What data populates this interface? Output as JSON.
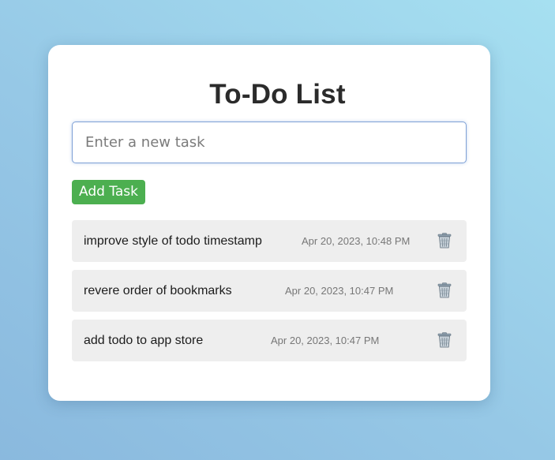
{
  "app": {
    "title": "To-Do List"
  },
  "input": {
    "placeholder": "Enter a new task",
    "value": ""
  },
  "add_button": {
    "label": "Add Task"
  },
  "tasks": [
    {
      "text": "improve style of todo timestamp",
      "timestamp": "Apr 20, 2023, 10:48 PM",
      "icon": "trash-icon"
    },
    {
      "text": "revere order of bookmarks",
      "timestamp": "Apr 20, 2023, 10:47 PM",
      "icon": "trash-icon"
    },
    {
      "text": "add todo to app store",
      "timestamp": "Apr 20, 2023, 10:47 PM",
      "icon": "trash-icon"
    }
  ],
  "colors": {
    "accent": "#4caf50",
    "card": "#ffffff",
    "task_background": "#eeeeee",
    "title_text": "#2b2b2b"
  }
}
